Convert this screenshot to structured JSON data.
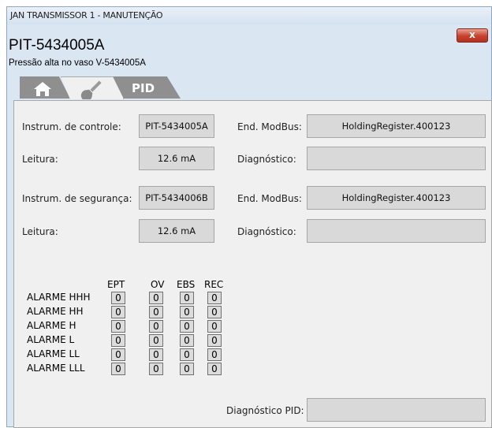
{
  "window": {
    "title": "JAN TRANSMISSOR 1 - MANUTENÇÃO",
    "close_label": "x"
  },
  "header": {
    "title": "PIT-5434005A",
    "subtitle": "Pressão alta no vaso V-5434005A"
  },
  "tabs": [
    {
      "icon": "home-icon",
      "active": false
    },
    {
      "icon": "wrench-icon",
      "active": true
    },
    {
      "label": "PID",
      "active": false
    }
  ],
  "control": {
    "label": "Instrum. de controle:",
    "value": "PIT-5434005A",
    "modbus_label": "End. ModBus:",
    "modbus_value": "HoldingRegister.400123",
    "reading_label": "Leitura:",
    "reading_value": "12.6 mA",
    "diag_label": "Diagnóstico:",
    "diag_value": ""
  },
  "safety": {
    "label": "Instrum. de segurança:",
    "value": "PIT-5434006B",
    "modbus_label": "End. ModBus:",
    "modbus_value": "HoldingRegister.400123",
    "reading_label": "Leitura:",
    "reading_value": "12.6 mA",
    "diag_label": "Diagnóstico:",
    "diag_value": ""
  },
  "alarms": {
    "columns": [
      "EPT",
      "OV",
      "EBS",
      "REC"
    ],
    "rows": [
      {
        "name": "ALARME HHH",
        "values": [
          "0",
          "0",
          "0",
          "0"
        ]
      },
      {
        "name": "ALARME HH",
        "values": [
          "0",
          "0",
          "0",
          "0"
        ]
      },
      {
        "name": "ALARME H",
        "values": [
          "0",
          "0",
          "0",
          "0"
        ]
      },
      {
        "name": "ALARME L",
        "values": [
          "0",
          "0",
          "0",
          "0"
        ]
      },
      {
        "name": "ALARME LL",
        "values": [
          "0",
          "0",
          "0",
          "0"
        ]
      },
      {
        "name": "ALARME LLL",
        "values": [
          "0",
          "0",
          "0",
          "0"
        ]
      }
    ]
  },
  "pid_diag": {
    "label": "Diagnóstico PID:",
    "value": ""
  }
}
